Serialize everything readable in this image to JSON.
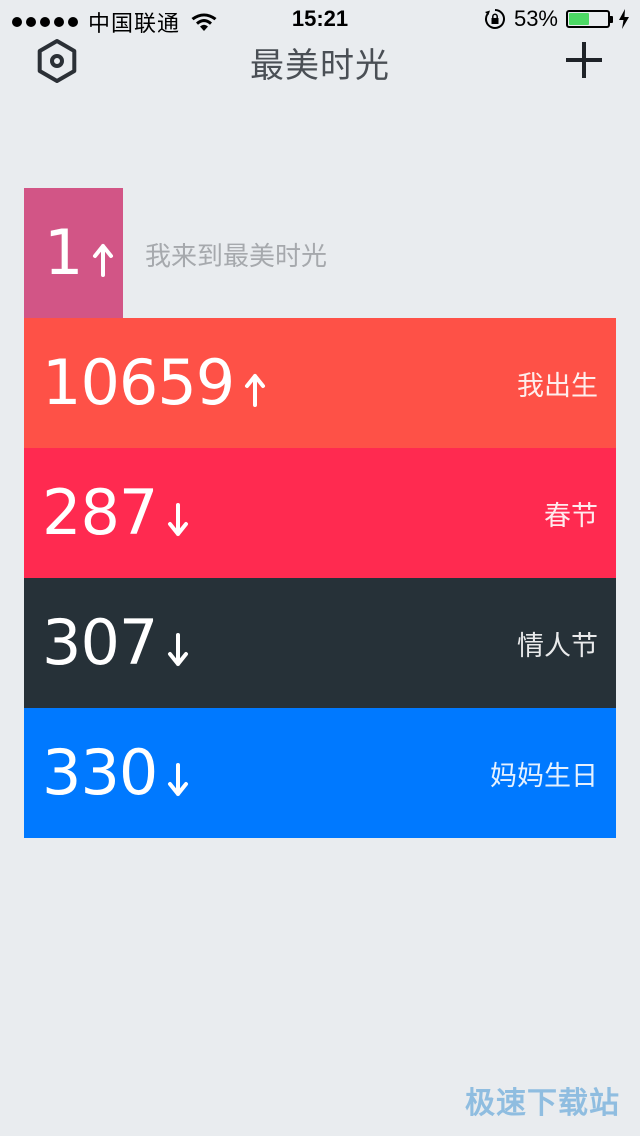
{
  "status_bar": {
    "carrier": "中国联通",
    "time": "15:21",
    "battery_percent": "53%",
    "battery_level": 0.53,
    "icons": [
      "signal-dots-icon",
      "wifi-icon",
      "rotation-lock-icon",
      "battery-icon",
      "charging-bolt-icon"
    ]
  },
  "nav": {
    "title": "最美时光",
    "settings_icon": "hexagon-settings-icon",
    "add_icon": "plus-icon"
  },
  "first_item": {
    "number": "1",
    "direction": "up",
    "label": "我来到最美时光",
    "color": "#d25586"
  },
  "rows": [
    {
      "number": "10659",
      "direction": "up",
      "label": "我出生",
      "color": "#fe5147"
    },
    {
      "number": "287",
      "direction": "down",
      "label": "春节",
      "color": "#ff2a50"
    },
    {
      "number": "307",
      "direction": "down",
      "label": "情人节",
      "color": "#263138"
    },
    {
      "number": "330",
      "direction": "down",
      "label": "妈妈生日",
      "color": "#0079ff"
    }
  ],
  "watermark": "极速下载站"
}
